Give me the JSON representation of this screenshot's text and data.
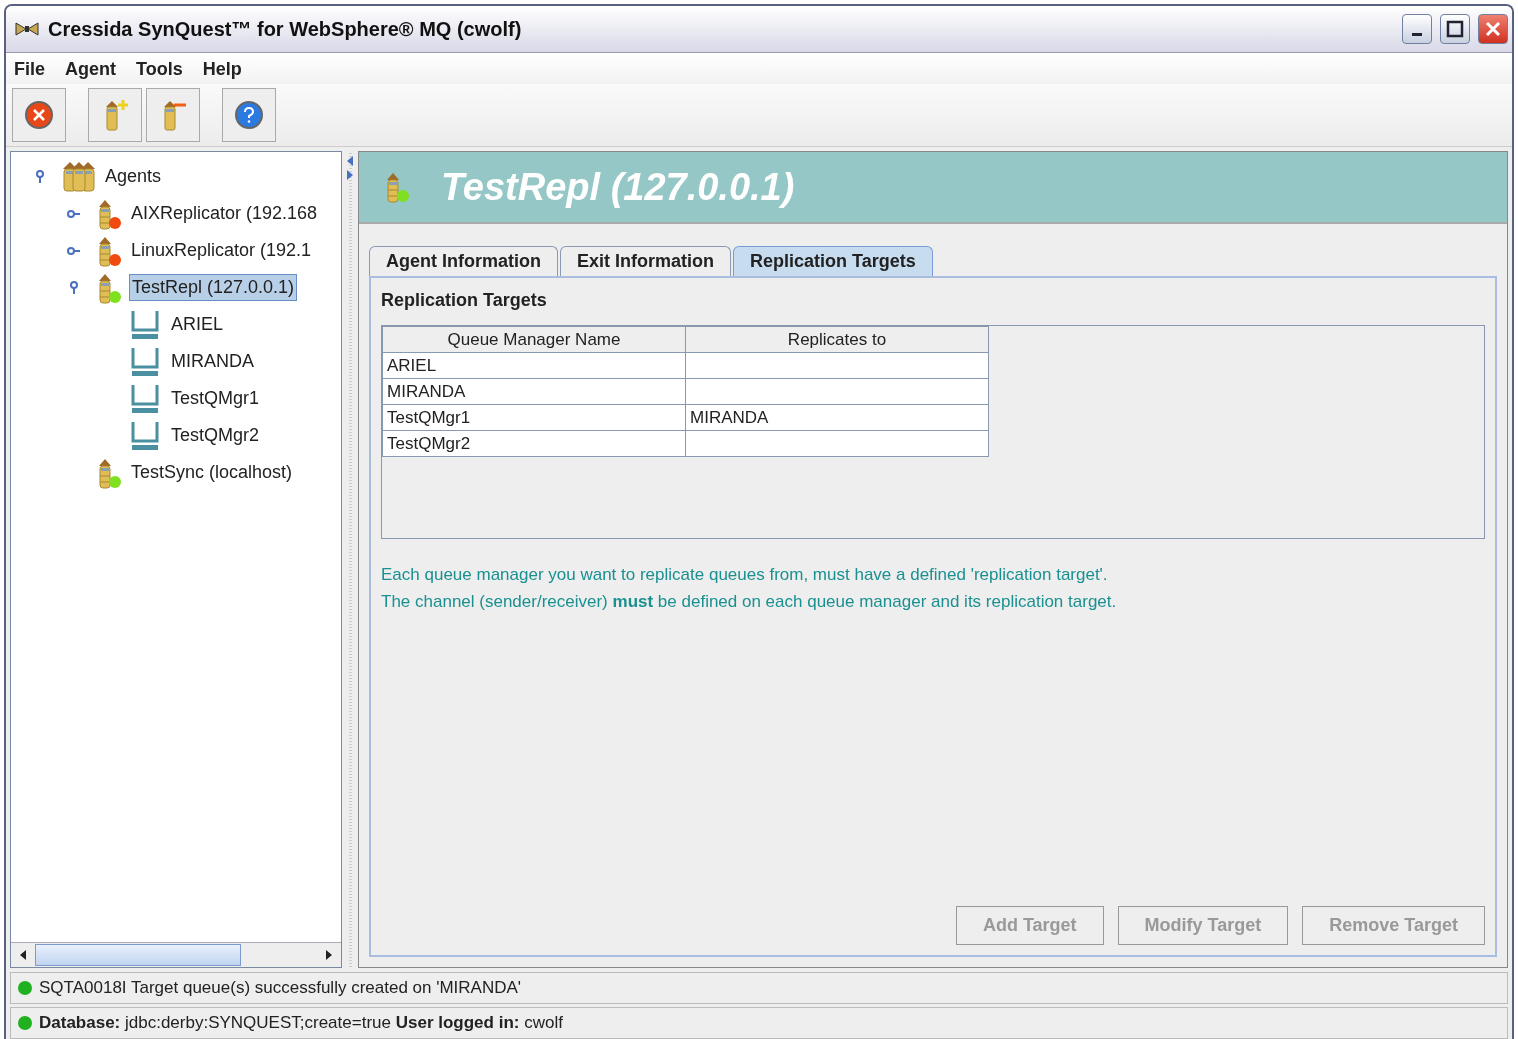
{
  "window": {
    "title": "Cressida SynQuest™ for WebSphere® MQ (cwolf)"
  },
  "menu": [
    "File",
    "Agent",
    "Tools",
    "Help"
  ],
  "toolbar": [
    {
      "kind": "exit"
    },
    {
      "kind": "add-agent"
    },
    {
      "kind": "remove-agent"
    },
    {
      "kind": "help"
    }
  ],
  "tree": {
    "label": "Agents",
    "expanded": true,
    "children": [
      {
        "kind": "agent",
        "label": "AIXReplicator (192.168",
        "color": "#f04a10",
        "expanded": false,
        "selected": false
      },
      {
        "kind": "agent",
        "label": "LinuxReplicator (192.1",
        "color": "#f04a10",
        "expanded": false,
        "selected": false
      },
      {
        "kind": "agent",
        "label": "TestRepl (127.0.0.1)",
        "color": "#7fe020",
        "expanded": true,
        "selected": true,
        "children": [
          {
            "kind": "qmgr",
            "label": "ARIEL",
            "selected": false
          },
          {
            "kind": "qmgr",
            "label": "MIRANDA",
            "selected": false
          },
          {
            "kind": "qmgr",
            "label": "TestQMgr1",
            "selected": false
          },
          {
            "kind": "qmgr",
            "label": "TestQMgr2",
            "selected": false
          }
        ]
      },
      {
        "kind": "leaf-agent",
        "label": "TestSync (localhost)",
        "color": "#7fe020",
        "selected": false
      }
    ]
  },
  "header": {
    "title": "TestRepl (127.0.0.1)",
    "color": "#7fe020"
  },
  "tabs": [
    {
      "label": "Agent Information",
      "selected": false
    },
    {
      "label": "Exit Information",
      "selected": false
    },
    {
      "label": "Replication Targets",
      "selected": true
    }
  ],
  "section_title": "Replication Targets",
  "table": {
    "columns": [
      "Queue Manager Name",
      "Replicates to"
    ],
    "rows": [
      [
        "ARIEL",
        ""
      ],
      [
        "MIRANDA",
        ""
      ],
      [
        "TestQMgr1",
        "MIRANDA"
      ],
      [
        "TestQMgr2",
        ""
      ]
    ]
  },
  "info": [
    "Each queue manager you want to replicate queues from, must have a defined 'replication target'.",
    "The channel (sender/receiver) **must** be defined on each queue manager and its replication target."
  ],
  "buttons": [
    {
      "label": "Add Target",
      "disabled": true
    },
    {
      "label": "Modify Target",
      "disabled": true
    },
    {
      "label": "Remove Target",
      "disabled": true
    }
  ],
  "status": [
    {
      "text": "SQTA0018I Target queue(s) successfully created on 'MIRANDA'",
      "color": "#20b020"
    },
    {
      "text": "**Database:** jdbc:derby:SYNQUEST;create=true **User logged in:** cwolf",
      "color": "#20b020"
    }
  ]
}
